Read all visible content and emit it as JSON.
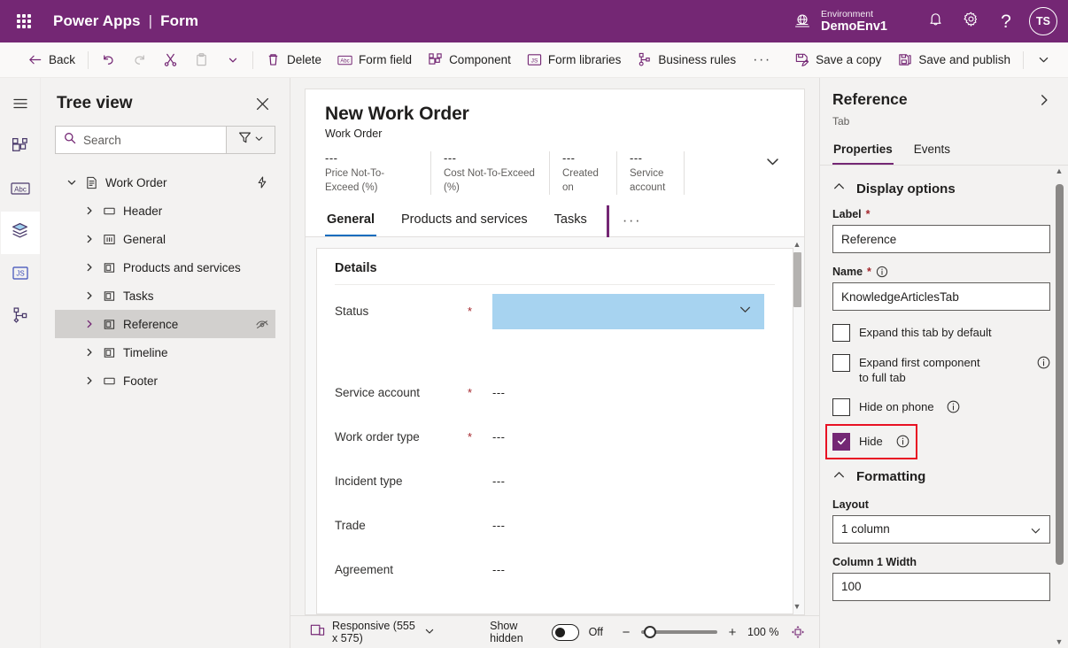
{
  "suitebar": {
    "waffle": "app-launcher",
    "brand": "Power Apps",
    "separator": "|",
    "app": "Form",
    "environment_label": "Environment",
    "environment_name": "DemoEnv1",
    "notifications_icon": "bell-icon",
    "settings_icon": "gear-icon",
    "help_icon": "help-icon",
    "avatar_initials": "TS",
    "background": "#742774"
  },
  "commandbar": {
    "back": "Back",
    "undo": "undo",
    "redo": "redo",
    "cut": "cut",
    "paste": "paste",
    "clipboard_more": "chevron-down",
    "delete": "Delete",
    "form_field": "Form field",
    "component": "Component",
    "form_libraries": "Form libraries",
    "business_rules": "Business rules",
    "overflow": "···",
    "save_a_copy": "Save a copy",
    "save_and_publish": "Save and publish",
    "save_more": "chevron-down"
  },
  "rail": {
    "items": [
      {
        "name": "menu",
        "icon": "hamburger-icon"
      },
      {
        "name": "components",
        "icon": "components-icon"
      },
      {
        "name": "form-fields",
        "icon": "abc-icon"
      },
      {
        "name": "tree-view",
        "icon": "layers-icon",
        "active": true
      },
      {
        "name": "form-libraries",
        "icon": "js-icon"
      },
      {
        "name": "business-rules",
        "icon": "business-rules-icon"
      }
    ]
  },
  "treeview": {
    "title": "Tree view",
    "close_icon": "close-icon",
    "search_placeholder": "Search",
    "search_value": "",
    "search_icon": "search-icon",
    "filter_icon": "filter-icon",
    "filter_chevron": "chevron-down-icon",
    "items": [
      {
        "label": "Work Order",
        "icon": "form-icon",
        "depth": 0,
        "expanded": true,
        "trailing": "flow-icon",
        "selected": false
      },
      {
        "label": "Header",
        "icon": "header-icon",
        "depth": 1,
        "expanded": false,
        "trailing": "",
        "selected": false
      },
      {
        "label": "General",
        "icon": "tab-icon",
        "depth": 1,
        "expanded": false,
        "trailing": "",
        "selected": false
      },
      {
        "label": "Products and services",
        "icon": "tab-icon",
        "depth": 1,
        "expanded": false,
        "trailing": "",
        "selected": false
      },
      {
        "label": "Tasks",
        "icon": "tab-icon",
        "depth": 1,
        "expanded": false,
        "trailing": "",
        "selected": false
      },
      {
        "label": "Reference",
        "icon": "tab-icon",
        "depth": 1,
        "expanded": false,
        "trailing": "hidden-eye-icon",
        "selected": true
      },
      {
        "label": "Timeline",
        "icon": "tab-icon",
        "depth": 1,
        "expanded": false,
        "trailing": "",
        "selected": false
      },
      {
        "label": "Footer",
        "icon": "header-icon",
        "depth": 1,
        "expanded": false,
        "trailing": "",
        "selected": false
      }
    ]
  },
  "canvas": {
    "form_title": "New Work Order",
    "form_subtitle": "Work Order",
    "header_chevron": "chevron-down-icon",
    "header_fields": [
      {
        "value": "---",
        "label": "Price Not-To-Exceed (%)"
      },
      {
        "value": "---",
        "label": "Cost Not-To-Exceed (%)"
      },
      {
        "value": "---",
        "label": "Created on"
      },
      {
        "value": "---",
        "label": "Service account"
      }
    ],
    "tabs": [
      {
        "label": "General",
        "active": true
      },
      {
        "label": "Products and services",
        "active": false
      },
      {
        "label": "Tasks",
        "active": false
      }
    ],
    "tab_overflow": "···",
    "section_title": "Details",
    "fields": [
      {
        "label": "Status",
        "required": true,
        "value": "",
        "control": "dropdown",
        "highlighted": true
      },
      {
        "label": "Service account",
        "required": true,
        "value": "---",
        "control": "text",
        "highlighted": false
      },
      {
        "label": "Work order type",
        "required": true,
        "value": "---",
        "control": "text",
        "highlighted": false
      },
      {
        "label": "Incident type",
        "required": false,
        "value": "---",
        "control": "text",
        "highlighted": false
      },
      {
        "label": "Trade",
        "required": false,
        "value": "---",
        "control": "text",
        "highlighted": false
      },
      {
        "label": "Agreement",
        "required": false,
        "value": "---",
        "control": "text",
        "highlighted": false
      }
    ],
    "highlight_color": "#a7d3f0",
    "drop_marker_color": "#742774"
  },
  "statusbar": {
    "device_icon": "responsive-icon",
    "device_label": "Responsive (555 x 575)",
    "device_chevron": "chevron-down-icon",
    "show_hidden_label": "Show hidden",
    "show_hidden_state": "Off",
    "zoom_minus": "−",
    "zoom_plus": "+",
    "zoom_value": "100 %",
    "fit_icon": "fit-to-screen-icon"
  },
  "properties": {
    "title": "Reference",
    "expand_icon": "chevron-right-icon",
    "type": "Tab",
    "tabs": [
      {
        "label": "Properties",
        "active": true
      },
      {
        "label": "Events",
        "active": false
      }
    ],
    "display_options": {
      "section_title": "Display options",
      "collapse_icon": "chevron-up-icon",
      "label_field_label": "Label",
      "label_field_required": "*",
      "label_field_value": "Reference",
      "name_field_label": "Name",
      "name_field_required": "*",
      "name_field_info": "info-icon",
      "name_field_value": "KnowledgeArticlesTab",
      "checkboxes": [
        {
          "label": "Expand this tab by default",
          "checked": false,
          "info": false
        },
        {
          "label": "Expand first component to full tab",
          "checked": false,
          "info": true
        },
        {
          "label": "Hide on phone",
          "checked": false,
          "info": true
        },
        {
          "label": "Hide",
          "checked": true,
          "info": true,
          "annotated": true
        }
      ]
    },
    "formatting": {
      "section_title": "Formatting",
      "collapse_icon": "chevron-up-icon",
      "layout_label": "Layout",
      "layout_value": "1 column",
      "layout_chevron": "chevron-down-icon",
      "column_width_label": "Column 1 Width",
      "column_width_value": "100"
    },
    "accent_color": "#742774",
    "annotation_color": "#e81123"
  }
}
